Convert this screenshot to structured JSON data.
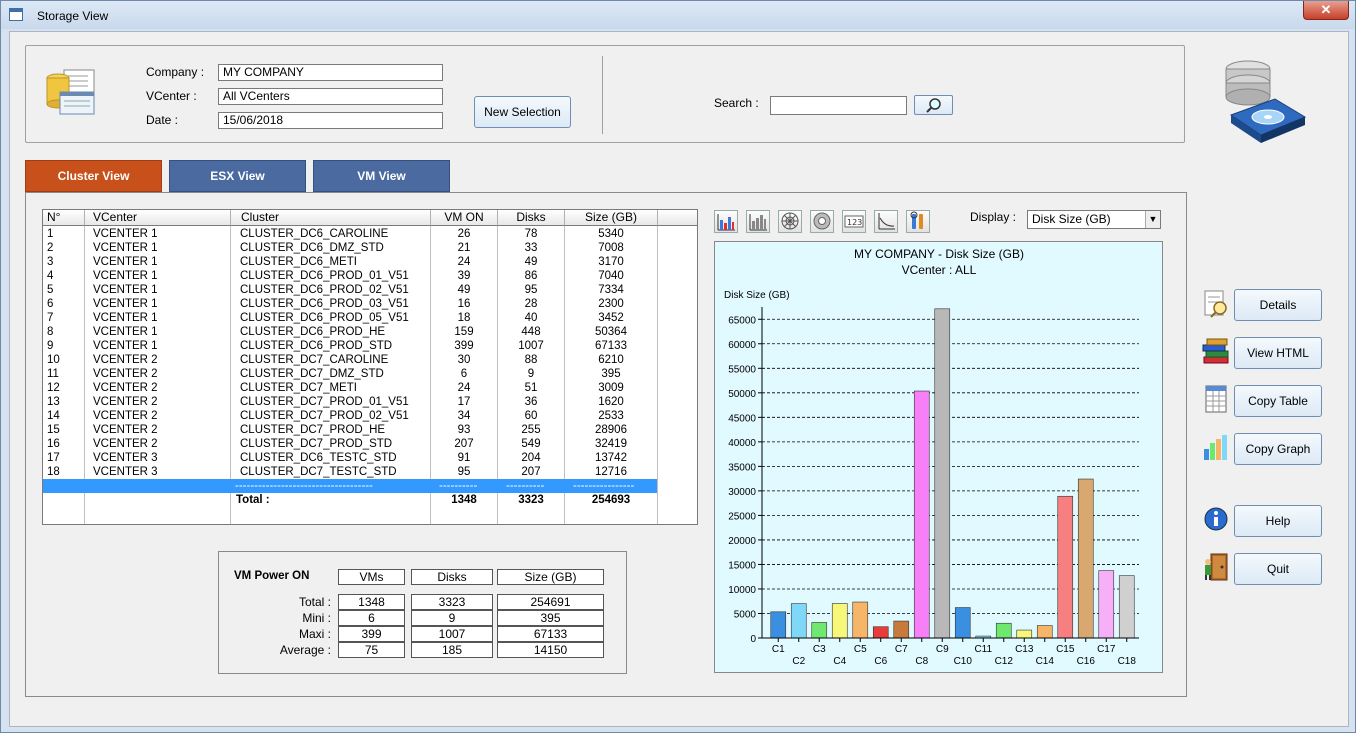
{
  "window": {
    "title": "Storage View",
    "close_label": "✕"
  },
  "selection": {
    "company_label": "Company :",
    "company_value": "MY COMPANY",
    "vcenter_label": "VCenter :",
    "vcenter_value": "All VCenters",
    "date_label": "Date :",
    "date_value": "15/06/2018",
    "new_selection_label": "New Selection",
    "search_label": "Search :",
    "search_value": ""
  },
  "tabs": [
    {
      "label": "Cluster View",
      "active": true
    },
    {
      "label": "ESX View",
      "active": false
    },
    {
      "label": "VM View",
      "active": false
    }
  ],
  "table": {
    "columns": [
      "N°",
      "VCenter",
      "Cluster",
      "VM ON",
      "Disks",
      "Size (GB)"
    ],
    "rows": [
      [
        "1",
        "VCENTER 1",
        "CLUSTER_DC6_CAROLINE",
        "26",
        "78",
        "5340"
      ],
      [
        "2",
        "VCENTER 1",
        "CLUSTER_DC6_DMZ_STD",
        "21",
        "33",
        "7008"
      ],
      [
        "3",
        "VCENTER 1",
        "CLUSTER_DC6_METI",
        "24",
        "49",
        "3170"
      ],
      [
        "4",
        "VCENTER 1",
        "CLUSTER_DC6_PROD_01_V51",
        "39",
        "86",
        "7040"
      ],
      [
        "5",
        "VCENTER 1",
        "CLUSTER_DC6_PROD_02_V51",
        "49",
        "95",
        "7334"
      ],
      [
        "6",
        "VCENTER 1",
        "CLUSTER_DC6_PROD_03_V51",
        "16",
        "28",
        "2300"
      ],
      [
        "7",
        "VCENTER 1",
        "CLUSTER_DC6_PROD_05_V51",
        "18",
        "40",
        "3452"
      ],
      [
        "8",
        "VCENTER 1",
        "CLUSTER_DC6_PROD_HE",
        "159",
        "448",
        "50364"
      ],
      [
        "9",
        "VCENTER 1",
        "CLUSTER_DC6_PROD_STD",
        "399",
        "1007",
        "67133"
      ],
      [
        "10",
        "VCENTER 2",
        "CLUSTER_DC7_CAROLINE",
        "30",
        "88",
        "6210"
      ],
      [
        "11",
        "VCENTER 2",
        "CLUSTER_DC7_DMZ_STD",
        "6",
        "9",
        "395"
      ],
      [
        "12",
        "VCENTER 2",
        "CLUSTER_DC7_METI",
        "24",
        "51",
        "3009"
      ],
      [
        "13",
        "VCENTER 2",
        "CLUSTER_DC7_PROD_01_V51",
        "17",
        "36",
        "1620"
      ],
      [
        "14",
        "VCENTER 2",
        "CLUSTER_DC7_PROD_02_V51",
        "34",
        "60",
        "2533"
      ],
      [
        "15",
        "VCENTER 2",
        "CLUSTER_DC7_PROD_HE",
        "93",
        "255",
        "28906"
      ],
      [
        "16",
        "VCENTER 2",
        "CLUSTER_DC7_PROD_STD",
        "207",
        "549",
        "32419"
      ],
      [
        "17",
        "VCENTER 3",
        "CLUSTER_DC6_TESTC_STD",
        "91",
        "204",
        "13742"
      ],
      [
        "18",
        "VCENTER 3",
        "CLUSTER_DC7_TESTC_STD",
        "95",
        "207",
        "12716"
      ]
    ],
    "separator": {
      "cluster": "------------------------------------",
      "vmon": "----------",
      "disks": "----------",
      "size": "----------------"
    },
    "total": {
      "label": "Total :",
      "vmon": "1348",
      "disks": "3323",
      "size": "254693"
    }
  },
  "summary": {
    "title": "VM Power ON",
    "headers": [
      "VMs",
      "Disks",
      "Size (GB)"
    ],
    "rows": [
      {
        "label": "Total :",
        "values": [
          "1348",
          "3323",
          "254691"
        ]
      },
      {
        "label": "Mini :",
        "values": [
          "6",
          "9",
          "395"
        ]
      },
      {
        "label": "Maxi :",
        "values": [
          "399",
          "1007",
          "67133"
        ]
      },
      {
        "label": "Average :",
        "values": [
          "75",
          "185",
          "14150"
        ]
      }
    ]
  },
  "toolbar_icons": [
    "bar-chart-icon",
    "column-chart-icon",
    "radar-chart-icon",
    "donut-chart-icon",
    "numbers-icon",
    "axis-chart-icon",
    "settings-tools-icon"
  ],
  "display": {
    "label": "Display :",
    "value": "Disk Size (GB)"
  },
  "chart_data": {
    "type": "bar",
    "title": "MY COMPANY - Disk Size (GB)",
    "subtitle": "VCenter : ALL",
    "ylabel": "Disk Size (GB)",
    "xlabel": "",
    "ylim": [
      0,
      67500
    ],
    "yticks": [
      0,
      5000,
      10000,
      15000,
      20000,
      25000,
      30000,
      35000,
      40000,
      45000,
      50000,
      55000,
      60000,
      65000
    ],
    "grid": true,
    "categories": [
      "C1",
      "C2",
      "C3",
      "C4",
      "C5",
      "C6",
      "C7",
      "C8",
      "C9",
      "C10",
      "C11",
      "C12",
      "C13",
      "C14",
      "C15",
      "C16",
      "C17",
      "C18"
    ],
    "values": [
      5340,
      7008,
      3170,
      7040,
      7334,
      2300,
      3452,
      50364,
      67133,
      6210,
      395,
      3009,
      1620,
      2533,
      28906,
      32419,
      13742,
      12716
    ],
    "colors": [
      "#3b8fe0",
      "#7fd8f7",
      "#6fe86f",
      "#f7f77a",
      "#f7b56a",
      "#e83b3b",
      "#c77a3b",
      "#f77ff7",
      "#b8b8b8",
      "#3b8fe0",
      "#7fd8f7",
      "#6fe86f",
      "#f7f77a",
      "#f7b56a",
      "#f77f7f",
      "#d8a870",
      "#f7b0f7",
      "#d0d0d0"
    ]
  },
  "side_buttons": [
    {
      "label": "Details",
      "icon": "details-icon"
    },
    {
      "label": "View HTML",
      "icon": "books-icon"
    },
    {
      "label": "Copy Table",
      "icon": "table-icon"
    },
    {
      "label": "Copy Graph",
      "icon": "graph-icon"
    },
    {
      "label": "Help",
      "icon": "info-icon"
    },
    {
      "label": "Quit",
      "icon": "exit-door-icon"
    }
  ]
}
